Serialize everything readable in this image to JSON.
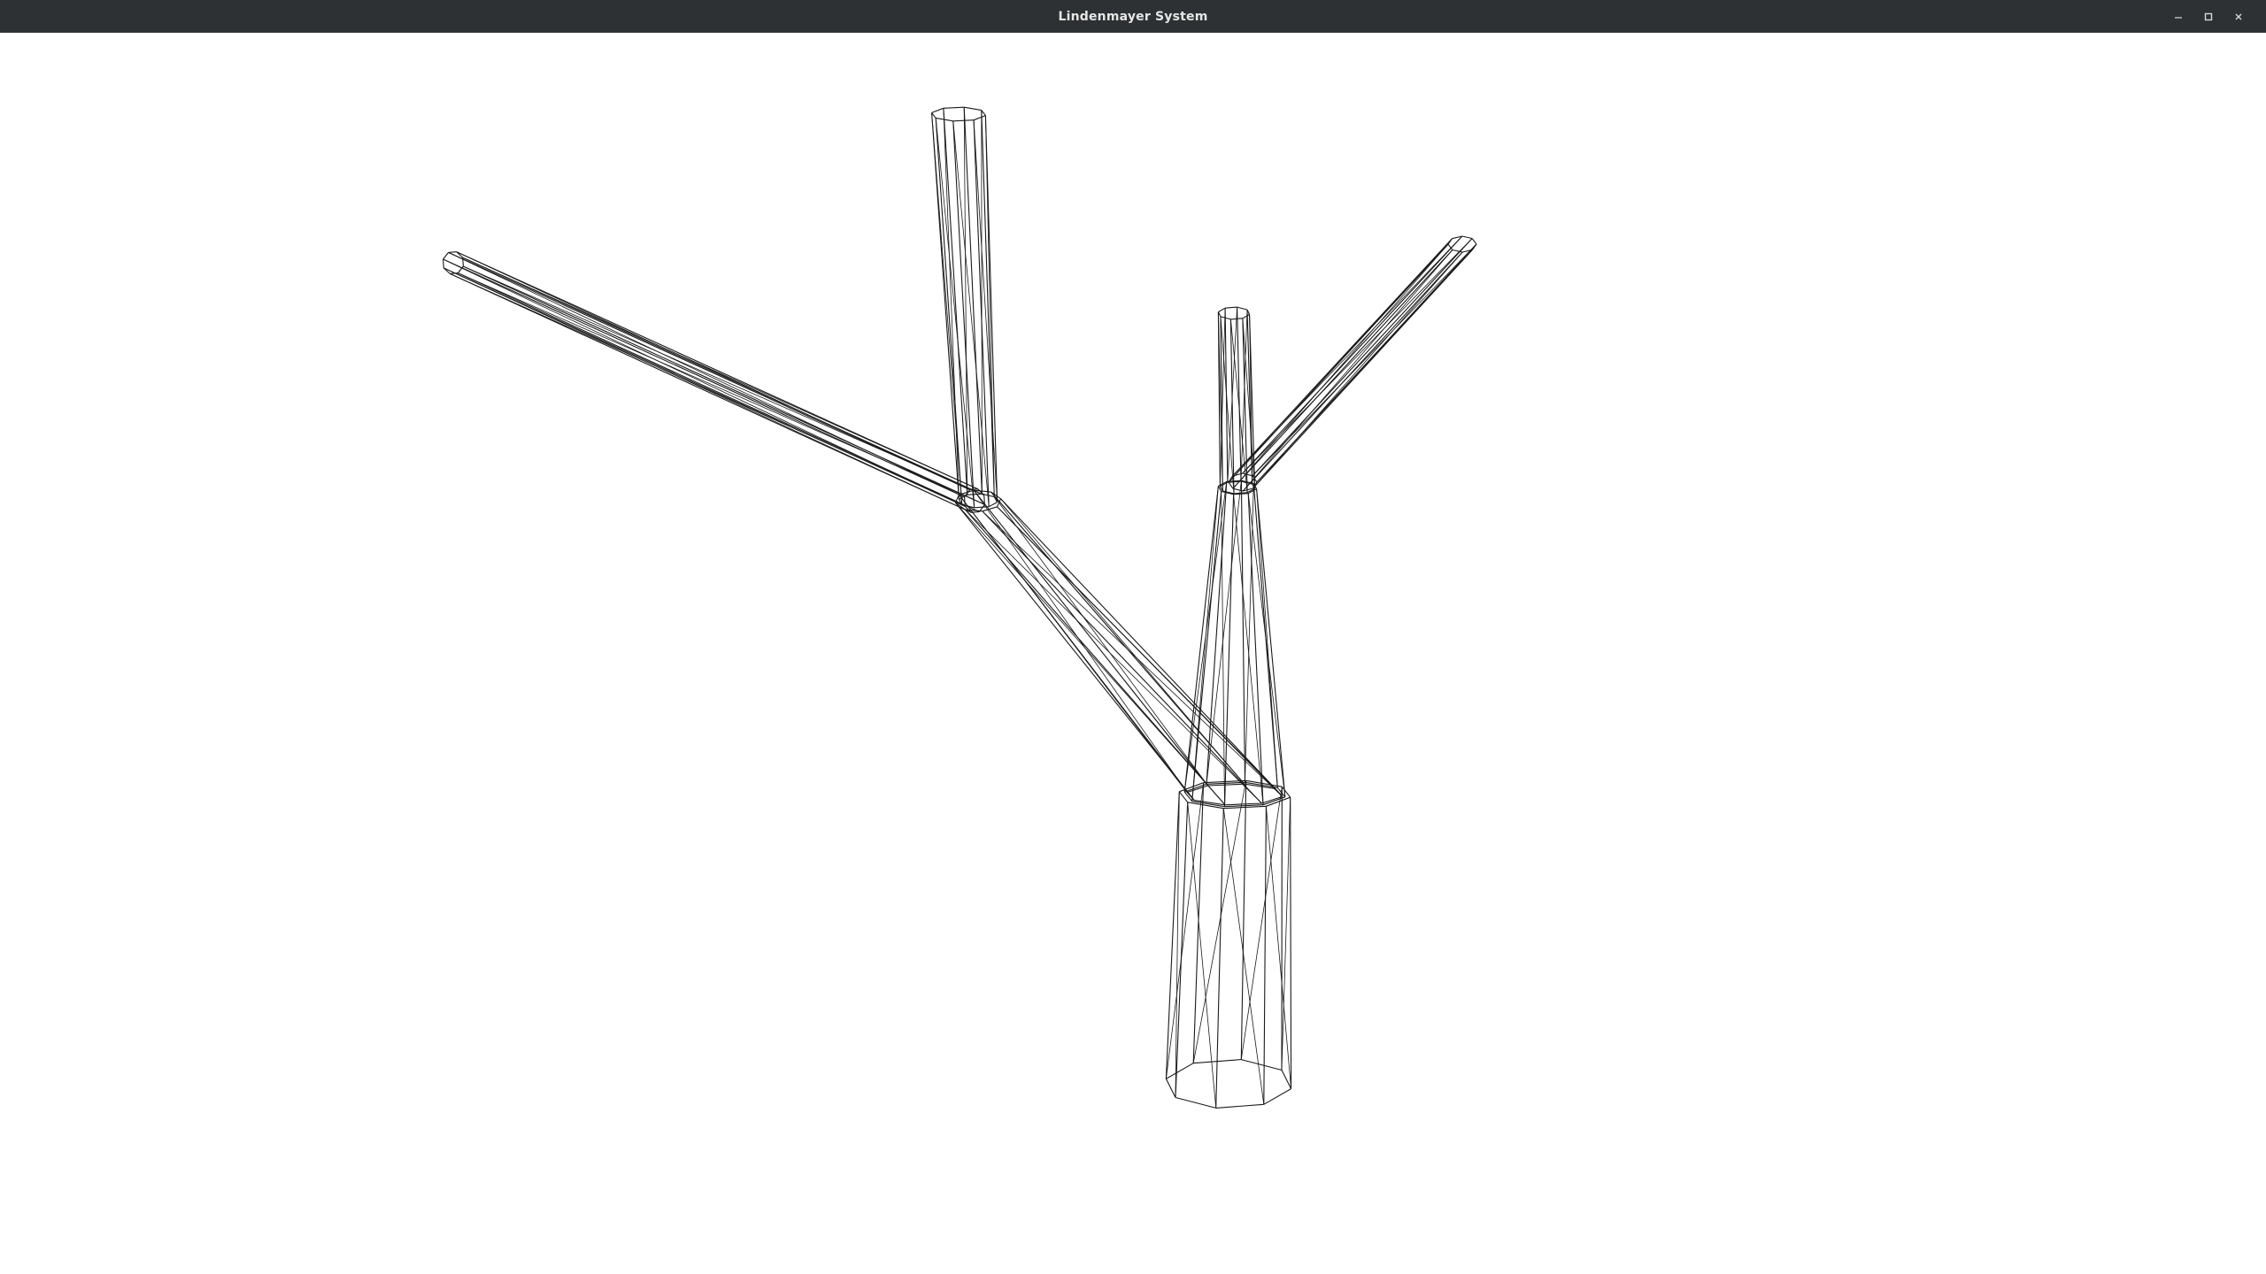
{
  "window": {
    "title": "Lindenmayer System",
    "controls": {
      "minimize_icon": "minimize-icon",
      "maximize_icon": "maximize-icon",
      "close_icon": "close-icon"
    }
  },
  "viewport": {
    "render_mode": "wireframe",
    "background_color": "#ffffff",
    "line_color": "#1a1a1a"
  }
}
